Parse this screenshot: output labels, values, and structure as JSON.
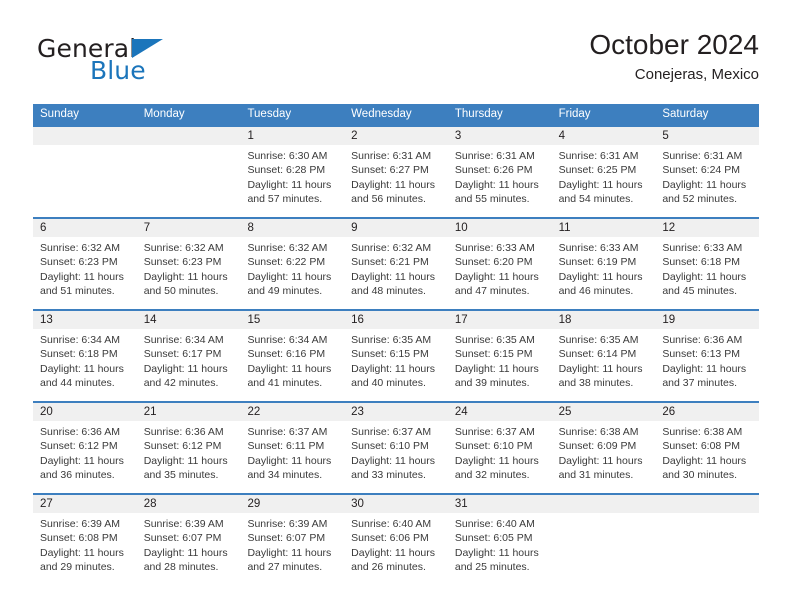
{
  "brand": {
    "name_part1": "General",
    "name_part2": "Blue",
    "triangle_color": "#1b75bb"
  },
  "header": {
    "title": "October 2024",
    "subtitle": "Conejeras, Mexico"
  },
  "colors": {
    "header_blue": "#3d7fbf",
    "date_band": "#f0f0f0",
    "text": "#231f20",
    "brand_blue": "#1b75bb"
  },
  "weekdays": [
    "Sunday",
    "Monday",
    "Tuesday",
    "Wednesday",
    "Thursday",
    "Friday",
    "Saturday"
  ],
  "weeks": [
    {
      "days": [
        {
          "date": "",
          "sunrise": "",
          "sunset": "",
          "daylight1": "",
          "daylight2": "",
          "empty": true
        },
        {
          "date": "",
          "sunrise": "",
          "sunset": "",
          "daylight1": "",
          "daylight2": "",
          "empty": true
        },
        {
          "date": "1",
          "sunrise": "Sunrise: 6:30 AM",
          "sunset": "Sunset: 6:28 PM",
          "daylight1": "Daylight: 11 hours",
          "daylight2": "and 57 minutes."
        },
        {
          "date": "2",
          "sunrise": "Sunrise: 6:31 AM",
          "sunset": "Sunset: 6:27 PM",
          "daylight1": "Daylight: 11 hours",
          "daylight2": "and 56 minutes."
        },
        {
          "date": "3",
          "sunrise": "Sunrise: 6:31 AM",
          "sunset": "Sunset: 6:26 PM",
          "daylight1": "Daylight: 11 hours",
          "daylight2": "and 55 minutes."
        },
        {
          "date": "4",
          "sunrise": "Sunrise: 6:31 AM",
          "sunset": "Sunset: 6:25 PM",
          "daylight1": "Daylight: 11 hours",
          "daylight2": "and 54 minutes."
        },
        {
          "date": "5",
          "sunrise": "Sunrise: 6:31 AM",
          "sunset": "Sunset: 6:24 PM",
          "daylight1": "Daylight: 11 hours",
          "daylight2": "and 52 minutes."
        }
      ]
    },
    {
      "days": [
        {
          "date": "6",
          "sunrise": "Sunrise: 6:32 AM",
          "sunset": "Sunset: 6:23 PM",
          "daylight1": "Daylight: 11 hours",
          "daylight2": "and 51 minutes."
        },
        {
          "date": "7",
          "sunrise": "Sunrise: 6:32 AM",
          "sunset": "Sunset: 6:23 PM",
          "daylight1": "Daylight: 11 hours",
          "daylight2": "and 50 minutes."
        },
        {
          "date": "8",
          "sunrise": "Sunrise: 6:32 AM",
          "sunset": "Sunset: 6:22 PM",
          "daylight1": "Daylight: 11 hours",
          "daylight2": "and 49 minutes."
        },
        {
          "date": "9",
          "sunrise": "Sunrise: 6:32 AM",
          "sunset": "Sunset: 6:21 PM",
          "daylight1": "Daylight: 11 hours",
          "daylight2": "and 48 minutes."
        },
        {
          "date": "10",
          "sunrise": "Sunrise: 6:33 AM",
          "sunset": "Sunset: 6:20 PM",
          "daylight1": "Daylight: 11 hours",
          "daylight2": "and 47 minutes."
        },
        {
          "date": "11",
          "sunrise": "Sunrise: 6:33 AM",
          "sunset": "Sunset: 6:19 PM",
          "daylight1": "Daylight: 11 hours",
          "daylight2": "and 46 minutes."
        },
        {
          "date": "12",
          "sunrise": "Sunrise: 6:33 AM",
          "sunset": "Sunset: 6:18 PM",
          "daylight1": "Daylight: 11 hours",
          "daylight2": "and 45 minutes."
        }
      ]
    },
    {
      "days": [
        {
          "date": "13",
          "sunrise": "Sunrise: 6:34 AM",
          "sunset": "Sunset: 6:18 PM",
          "daylight1": "Daylight: 11 hours",
          "daylight2": "and 44 minutes."
        },
        {
          "date": "14",
          "sunrise": "Sunrise: 6:34 AM",
          "sunset": "Sunset: 6:17 PM",
          "daylight1": "Daylight: 11 hours",
          "daylight2": "and 42 minutes."
        },
        {
          "date": "15",
          "sunrise": "Sunrise: 6:34 AM",
          "sunset": "Sunset: 6:16 PM",
          "daylight1": "Daylight: 11 hours",
          "daylight2": "and 41 minutes."
        },
        {
          "date": "16",
          "sunrise": "Sunrise: 6:35 AM",
          "sunset": "Sunset: 6:15 PM",
          "daylight1": "Daylight: 11 hours",
          "daylight2": "and 40 minutes."
        },
        {
          "date": "17",
          "sunrise": "Sunrise: 6:35 AM",
          "sunset": "Sunset: 6:15 PM",
          "daylight1": "Daylight: 11 hours",
          "daylight2": "and 39 minutes."
        },
        {
          "date": "18",
          "sunrise": "Sunrise: 6:35 AM",
          "sunset": "Sunset: 6:14 PM",
          "daylight1": "Daylight: 11 hours",
          "daylight2": "and 38 minutes."
        },
        {
          "date": "19",
          "sunrise": "Sunrise: 6:36 AM",
          "sunset": "Sunset: 6:13 PM",
          "daylight1": "Daylight: 11 hours",
          "daylight2": "and 37 minutes."
        }
      ]
    },
    {
      "days": [
        {
          "date": "20",
          "sunrise": "Sunrise: 6:36 AM",
          "sunset": "Sunset: 6:12 PM",
          "daylight1": "Daylight: 11 hours",
          "daylight2": "and 36 minutes."
        },
        {
          "date": "21",
          "sunrise": "Sunrise: 6:36 AM",
          "sunset": "Sunset: 6:12 PM",
          "daylight1": "Daylight: 11 hours",
          "daylight2": "and 35 minutes."
        },
        {
          "date": "22",
          "sunrise": "Sunrise: 6:37 AM",
          "sunset": "Sunset: 6:11 PM",
          "daylight1": "Daylight: 11 hours",
          "daylight2": "and 34 minutes."
        },
        {
          "date": "23",
          "sunrise": "Sunrise: 6:37 AM",
          "sunset": "Sunset: 6:10 PM",
          "daylight1": "Daylight: 11 hours",
          "daylight2": "and 33 minutes."
        },
        {
          "date": "24",
          "sunrise": "Sunrise: 6:37 AM",
          "sunset": "Sunset: 6:10 PM",
          "daylight1": "Daylight: 11 hours",
          "daylight2": "and 32 minutes."
        },
        {
          "date": "25",
          "sunrise": "Sunrise: 6:38 AM",
          "sunset": "Sunset: 6:09 PM",
          "daylight1": "Daylight: 11 hours",
          "daylight2": "and 31 minutes."
        },
        {
          "date": "26",
          "sunrise": "Sunrise: 6:38 AM",
          "sunset": "Sunset: 6:08 PM",
          "daylight1": "Daylight: 11 hours",
          "daylight2": "and 30 minutes."
        }
      ]
    },
    {
      "days": [
        {
          "date": "27",
          "sunrise": "Sunrise: 6:39 AM",
          "sunset": "Sunset: 6:08 PM",
          "daylight1": "Daylight: 11 hours",
          "daylight2": "and 29 minutes."
        },
        {
          "date": "28",
          "sunrise": "Sunrise: 6:39 AM",
          "sunset": "Sunset: 6:07 PM",
          "daylight1": "Daylight: 11 hours",
          "daylight2": "and 28 minutes."
        },
        {
          "date": "29",
          "sunrise": "Sunrise: 6:39 AM",
          "sunset": "Sunset: 6:07 PM",
          "daylight1": "Daylight: 11 hours",
          "daylight2": "and 27 minutes."
        },
        {
          "date": "30",
          "sunrise": "Sunrise: 6:40 AM",
          "sunset": "Sunset: 6:06 PM",
          "daylight1": "Daylight: 11 hours",
          "daylight2": "and 26 minutes."
        },
        {
          "date": "31",
          "sunrise": "Sunrise: 6:40 AM",
          "sunset": "Sunset: 6:05 PM",
          "daylight1": "Daylight: 11 hours",
          "daylight2": "and 25 minutes."
        },
        {
          "date": "",
          "sunrise": "",
          "sunset": "",
          "daylight1": "",
          "daylight2": "",
          "empty": true
        },
        {
          "date": "",
          "sunrise": "",
          "sunset": "",
          "daylight1": "",
          "daylight2": "",
          "empty": true
        }
      ]
    }
  ]
}
